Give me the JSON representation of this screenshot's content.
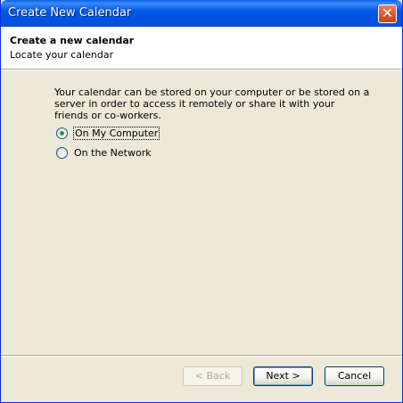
{
  "window": {
    "title": "Create New Calendar",
    "close_symbol": "✕"
  },
  "header": {
    "heading": "Create a new calendar",
    "subheading": "Locate your calendar"
  },
  "main": {
    "description": "Your calendar can be stored on your computer or be stored on a server in order to access it remotely or share it with your friends or co-workers.",
    "options": [
      {
        "label": "On My Computer",
        "selected": true
      },
      {
        "label": "On the Network",
        "selected": false
      }
    ]
  },
  "buttons": {
    "back": "< Back",
    "next": "Next >",
    "cancel": "Cancel"
  }
}
